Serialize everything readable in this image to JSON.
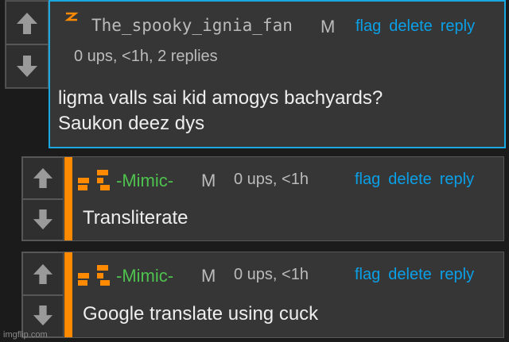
{
  "comments": [
    {
      "username": "The_spooky_ignia_fan",
      "badge": "M",
      "meta": "0 ups, <1h, 2 replies",
      "text_lines": [
        "ligma valls sai kid amogys bachyards?",
        "Saukon deez dys"
      ],
      "actions": [
        "flag",
        "delete",
        "reply"
      ]
    },
    {
      "username": "-Mimic-",
      "badge": "M",
      "meta": "0 ups, <1h",
      "text_lines": [
        "Transliterate"
      ],
      "actions": [
        "flag",
        "delete",
        "reply"
      ]
    },
    {
      "username": "-Mimic-",
      "badge": "M",
      "meta": "0 ups, <1h",
      "text_lines": [
        "Google translate using cuck"
      ],
      "actions": [
        "flag",
        "delete",
        "reply"
      ]
    }
  ],
  "icons": {
    "upvote": "arrow-up-icon",
    "downvote": "arrow-down-icon",
    "avatar_spooky": "lightning-avatar-icon",
    "avatar_mimic": "pixel-face-avatar-icon"
  },
  "colors": {
    "link": "#0aa0e8",
    "highlight_border": "#1aa8e0",
    "accent_bar": "#ff8a00",
    "mimic_name": "#4ec24e",
    "default_name": "#bbbbbb"
  },
  "watermark": "imgflip.com"
}
